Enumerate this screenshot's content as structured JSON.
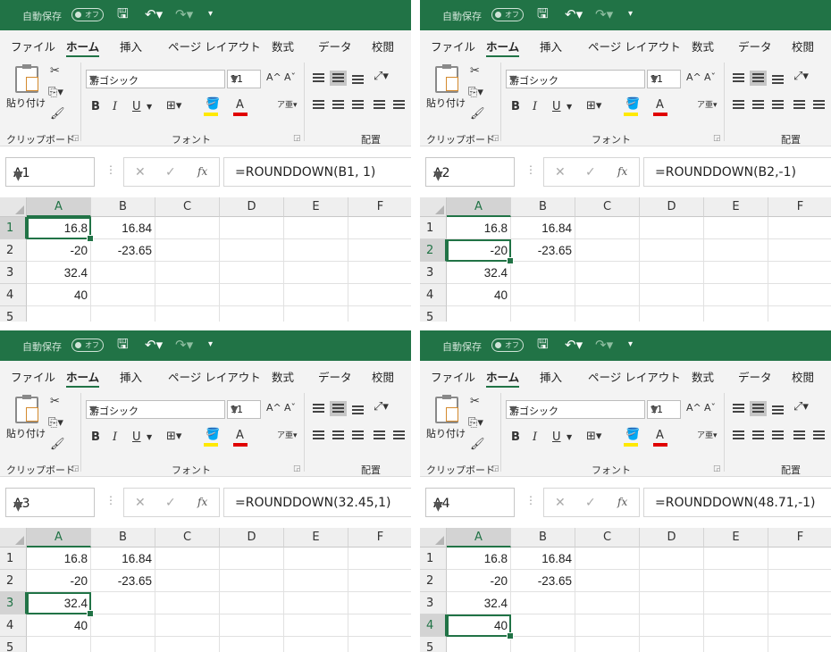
{
  "app": {
    "autosave_label": "自動保存",
    "autosave_state": "オフ",
    "tabs": [
      "ファイル",
      "ホーム",
      "挿入",
      "ページ レイアウト",
      "数式",
      "データ",
      "校閲"
    ],
    "active_tab": "ホーム",
    "ribbon": {
      "paste_label": "貼り付け",
      "clipboard_group": "クリップボード",
      "font_group": "フォント",
      "alignment_group": "配置",
      "font_name": "游ゴシック",
      "font_size": "11",
      "bold": "B",
      "italic": "I",
      "underline": "U",
      "font_color_letter": "A",
      "grow_font": "A^",
      "shrink_font": "Aˇ",
      "fill_color": "#ffe900",
      "font_color": "#e00000"
    },
    "columns": [
      "A",
      "B",
      "C",
      "D",
      "E",
      "F"
    ],
    "rows": [
      "1",
      "2",
      "3",
      "4",
      "5"
    ],
    "cells": [
      [
        "16.8",
        "16.84",
        "",
        "",
        "",
        ""
      ],
      [
        "-20",
        "-23.65",
        "",
        "",
        "",
        ""
      ],
      [
        "32.4",
        "",
        "",
        "",
        "",
        ""
      ],
      [
        "40",
        "",
        "",
        "",
        "",
        ""
      ],
      [
        "",
        "",
        "",
        "",
        "",
        ""
      ]
    ],
    "accent": "#217346"
  },
  "panels": [
    {
      "name_box": "A1",
      "formula": "=ROUNDDOWN(B1, 1)",
      "active_row": 0
    },
    {
      "name_box": "A2",
      "formula": "=ROUNDDOWN(B2,-1)",
      "active_row": 1
    },
    {
      "name_box": "A3",
      "formula": "=ROUNDDOWN(32.45,1)",
      "active_row": 2
    },
    {
      "name_box": "A4",
      "formula": "=ROUNDDOWN(48.71,-1)",
      "active_row": 3
    }
  ]
}
